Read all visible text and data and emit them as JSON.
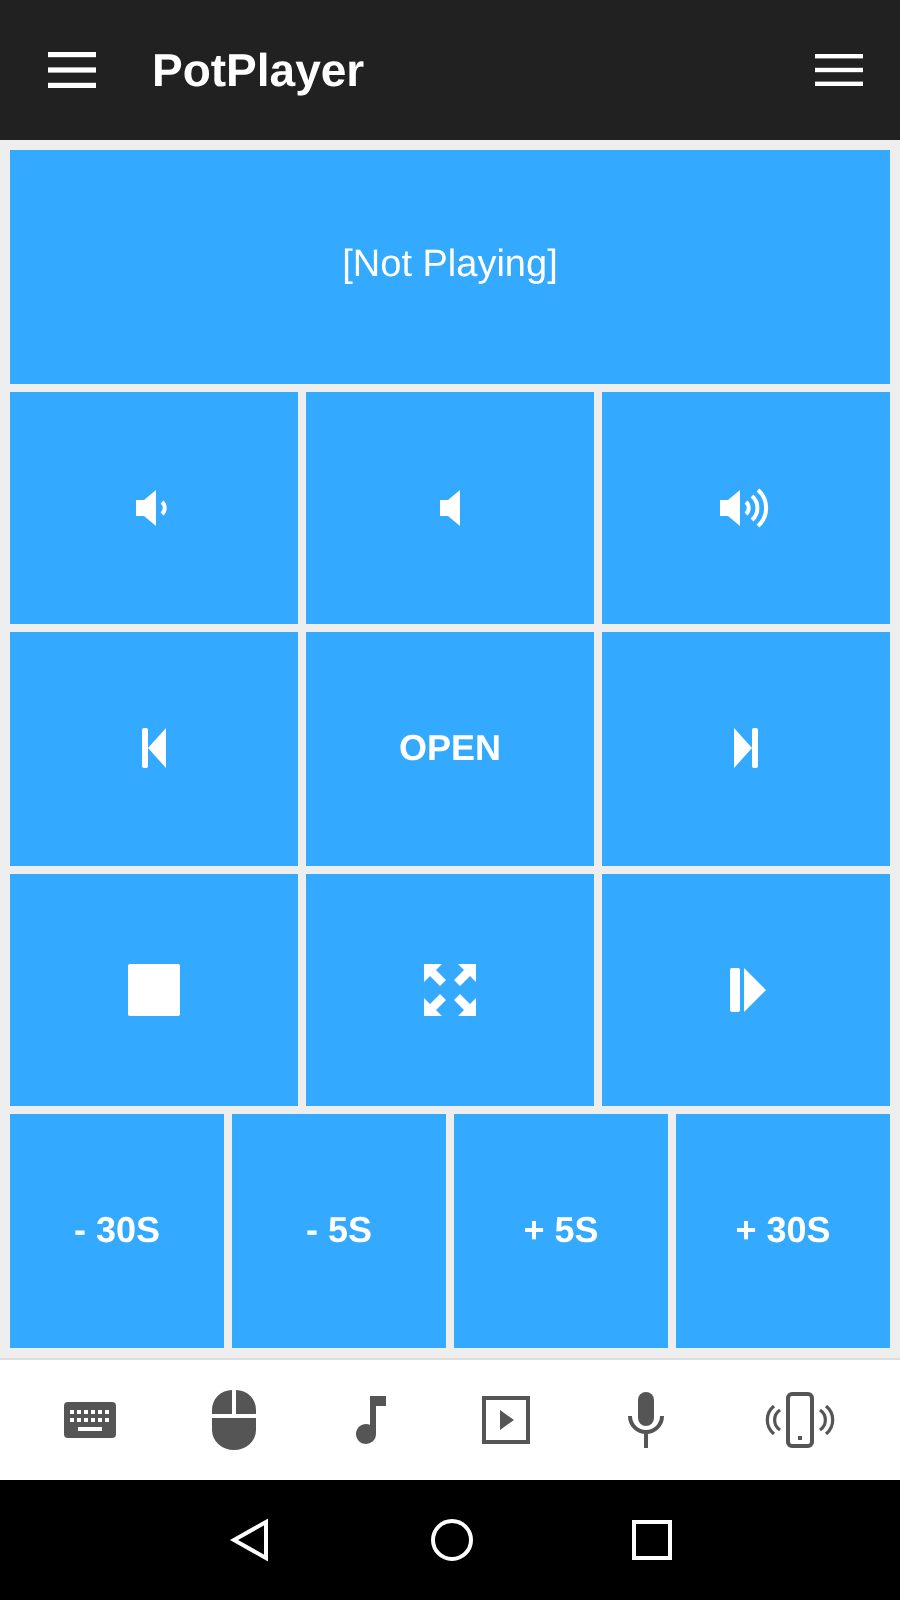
{
  "app_bar": {
    "title": "PotPlayer"
  },
  "now_playing": "[Not Playing]",
  "control_rows": [
    [
      {
        "kind": "icon"
      },
      {
        "kind": "icon"
      },
      {
        "kind": "icon"
      }
    ],
    [
      {
        "kind": "icon"
      },
      {
        "kind": "text",
        "label": "OPEN"
      },
      {
        "kind": "icon"
      }
    ],
    [
      {
        "kind": "icon"
      },
      {
        "kind": "icon"
      },
      {
        "kind": "icon"
      }
    ],
    [
      {
        "kind": "text",
        "label": "- 30S"
      },
      {
        "kind": "text",
        "label": "- 5S"
      },
      {
        "kind": "text",
        "label": "+ 5S"
      },
      {
        "kind": "text",
        "label": "+ 30S"
      }
    ]
  ]
}
